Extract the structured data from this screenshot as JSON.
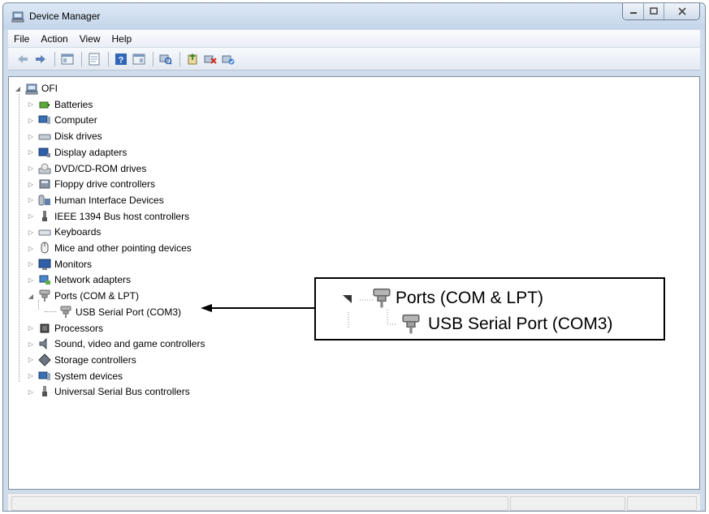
{
  "window": {
    "title": "Device Manager"
  },
  "menu": [
    "File",
    "Action",
    "View",
    "Help"
  ],
  "tree": {
    "root": "OFI",
    "items": [
      {
        "label": "Batteries",
        "icon": "battery-icon"
      },
      {
        "label": "Computer",
        "icon": "computer-icon"
      },
      {
        "label": "Disk drives",
        "icon": "disk-drive-icon"
      },
      {
        "label": "Display adapters",
        "icon": "display-adapter-icon"
      },
      {
        "label": "DVD/CD-ROM drives",
        "icon": "dvd-drive-icon"
      },
      {
        "label": "Floppy drive controllers",
        "icon": "floppy-controller-icon"
      },
      {
        "label": "Human Interface Devices",
        "icon": "hid-icon"
      },
      {
        "label": "IEEE 1394 Bus host controllers",
        "icon": "ieee1394-icon"
      },
      {
        "label": "Keyboards",
        "icon": "keyboard-icon"
      },
      {
        "label": "Mice and other pointing devices",
        "icon": "mouse-icon"
      },
      {
        "label": "Monitors",
        "icon": "monitor-icon"
      },
      {
        "label": "Network adapters",
        "icon": "network-adapter-icon"
      },
      {
        "label": "Ports (COM & LPT)",
        "icon": "port-icon"
      },
      {
        "label": "USB Serial Port (COM3)",
        "icon": "port-icon"
      },
      {
        "label": "Processors",
        "icon": "processor-icon"
      },
      {
        "label": "Sound, video and game controllers",
        "icon": "sound-icon"
      },
      {
        "label": "Storage controllers",
        "icon": "storage-icon"
      },
      {
        "label": "System devices",
        "icon": "system-device-icon"
      },
      {
        "label": "Universal Serial Bus controllers",
        "icon": "usb-icon"
      }
    ]
  },
  "callout": {
    "line1": "Ports (COM & LPT)",
    "line2": "USB Serial Port (COM3)"
  }
}
